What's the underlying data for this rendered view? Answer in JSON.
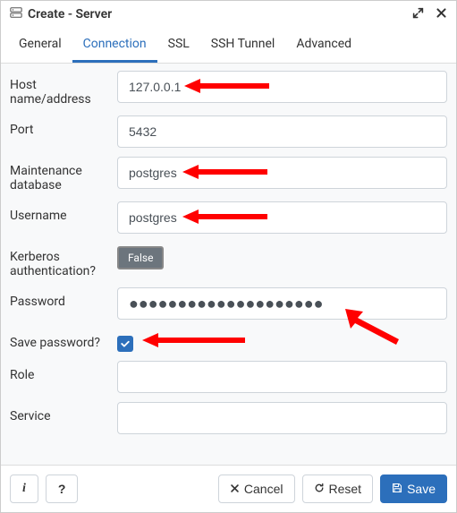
{
  "dialog": {
    "title": "Create - Server"
  },
  "tabs": {
    "general": "General",
    "connection": "Connection",
    "ssl": "SSL",
    "ssh": "SSH Tunnel",
    "advanced": "Advanced",
    "active": "connection"
  },
  "form": {
    "host": {
      "label": "Host name/address",
      "value": "127.0.0.1"
    },
    "port": {
      "label": "Port",
      "value": "5432"
    },
    "maintdb": {
      "label": "Maintenance database",
      "value": "postgres"
    },
    "username": {
      "label": "Username",
      "value": "postgres"
    },
    "kerberos": {
      "label": "Kerberos authentication?",
      "toggle": "False"
    },
    "password": {
      "label": "Password",
      "value": "●●●●●●●●●●●●●●●●●●●●"
    },
    "savepw": {
      "label": "Save password?",
      "checked": true
    },
    "role": {
      "label": "Role",
      "value": ""
    },
    "service": {
      "label": "Service",
      "value": ""
    }
  },
  "footer": {
    "info": "i",
    "help": "?",
    "cancel": "Cancel",
    "reset": "Reset",
    "save": "Save"
  },
  "colors": {
    "accent": "#2c6fbb",
    "arrow": "#ff0000"
  }
}
